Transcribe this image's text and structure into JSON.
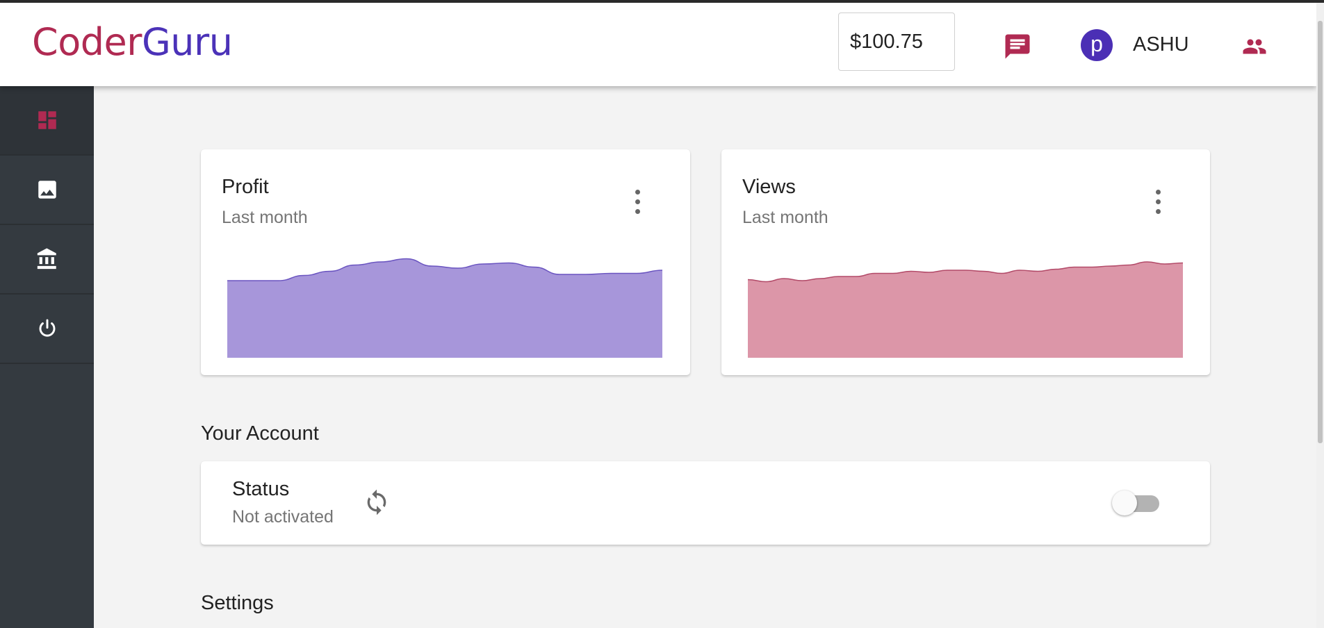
{
  "app": {
    "logo_part1": "Coder",
    "logo_part2": "Guru"
  },
  "header": {
    "balance": "$100.75",
    "avatar_letter": "p",
    "username": "ASHU",
    "icons": [
      "message-icon",
      "avatar",
      "users-icon"
    ]
  },
  "sidebar": {
    "items": [
      {
        "icon": "dashboard-icon",
        "active": true
      },
      {
        "icon": "image-icon",
        "active": false
      },
      {
        "icon": "bank-icon",
        "active": false
      },
      {
        "icon": "power-icon",
        "active": false
      }
    ]
  },
  "cards": [
    {
      "title": "Profit",
      "subtitle": "Last month"
    },
    {
      "title": "Views",
      "subtitle": "Last month"
    }
  ],
  "chart_data": [
    {
      "type": "area",
      "title": "Profit",
      "color": "#a796da",
      "line_color": "#6a54c0",
      "ylim": [
        0,
        100
      ],
      "values": [
        74,
        74,
        74,
        79,
        83,
        89,
        92,
        95,
        88,
        86,
        90,
        91,
        87,
        80,
        80,
        81,
        81,
        84
      ]
    },
    {
      "type": "area",
      "title": "Views",
      "color": "#dc96a8",
      "line_color": "#b24a68",
      "ylim": [
        0,
        100
      ],
      "values": [
        75,
        73,
        76,
        74,
        76,
        78,
        78,
        81,
        81,
        83,
        82,
        84,
        84,
        83,
        81,
        84,
        83,
        85,
        87,
        87,
        88,
        89,
        92,
        90,
        91
      ]
    }
  ],
  "account": {
    "section_title": "Your Account",
    "status_label": "Status",
    "status_value": "Not activated",
    "toggle_on": false
  },
  "settings": {
    "section_title": "Settings"
  }
}
